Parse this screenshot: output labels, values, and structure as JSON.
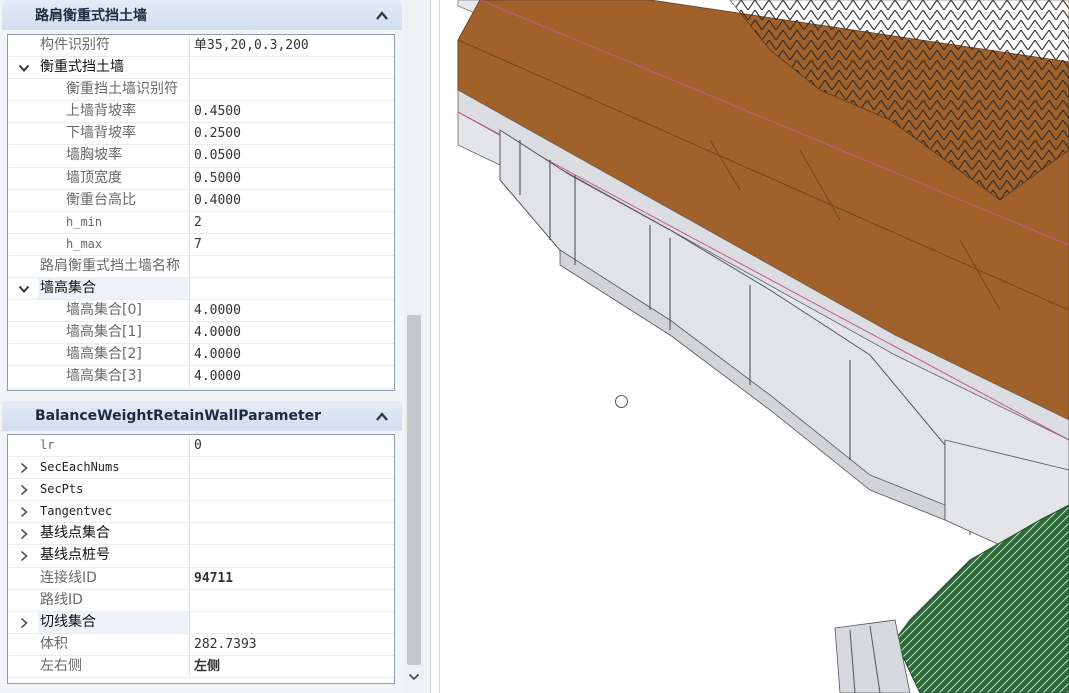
{
  "panel1": {
    "title": "路肩衡重式挡土墙",
    "rows": [
      {
        "name": "构件识别符",
        "value": "单35,20,0.3,200"
      },
      {
        "name": "衡重式挡土墙",
        "value": ""
      },
      {
        "name": "衡重挡土墙识别符",
        "value": ""
      },
      {
        "name": "上墙背坡率",
        "value": "0.4500"
      },
      {
        "name": "下墙背坡率",
        "value": "0.2500"
      },
      {
        "name": "墙胸坡率",
        "value": "0.0500"
      },
      {
        "name": "墙顶宽度",
        "value": "0.5000"
      },
      {
        "name": "衡重台高比",
        "value": "0.4000"
      },
      {
        "name": "h_min",
        "value": "2"
      },
      {
        "name": "h_max",
        "value": "7"
      },
      {
        "name": "路肩衡重式挡土墙名称",
        "value": ""
      },
      {
        "name": "墙高集合",
        "value": ""
      },
      {
        "name": "墙高集合[0]",
        "value": "4.0000"
      },
      {
        "name": "墙高集合[1]",
        "value": "4.0000"
      },
      {
        "name": "墙高集合[2]",
        "value": "4.0000"
      },
      {
        "name": "墙高集合[3]",
        "value": "4.0000"
      }
    ]
  },
  "panel2": {
    "title": "BalanceWeightRetainWallParameter",
    "rows": [
      {
        "name": "lr",
        "value": "0"
      },
      {
        "name": "SecEachNums",
        "value": ""
      },
      {
        "name": "SecPts",
        "value": ""
      },
      {
        "name": "Tangentvec",
        "value": ""
      },
      {
        "name": "基线点集合",
        "value": ""
      },
      {
        "name": "基线点桩号",
        "value": ""
      },
      {
        "name": "连接线ID",
        "value": "94711"
      },
      {
        "name": "路线ID",
        "value": ""
      },
      {
        "name": "切线集合",
        "value": ""
      },
      {
        "name": "体积",
        "value": "282.7393"
      },
      {
        "name": "左右侧",
        "value": "左侧"
      }
    ]
  },
  "icons": {
    "collapse": "chevron-up-icon",
    "expanded": "chevron-down-icon",
    "collapsed": "chevron-right-icon",
    "scroll_down": "scroll-down-arrow-icon",
    "cursor": "cursor-circle-icon"
  },
  "colors": {
    "header_bg": "#d2ddee",
    "road_surface": "#a0622a",
    "wall": "#e2e3e6",
    "vegetation": "#2f6b3a"
  }
}
